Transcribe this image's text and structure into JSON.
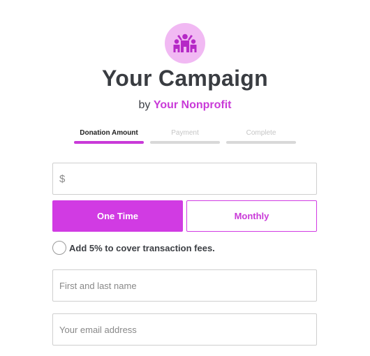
{
  "campaign": {
    "title": "Your Campaign",
    "by_prefix": "by",
    "organization": "Your Nonprofit",
    "logo_icon": "people-group-icon",
    "accent_color": "#d13be3"
  },
  "steps": [
    {
      "label": "Donation Amount",
      "state": "active"
    },
    {
      "label": "Payment",
      "state": "inactive"
    },
    {
      "label": "Complete",
      "state": "inactive"
    }
  ],
  "amount": {
    "currency_symbol": "$",
    "value": ""
  },
  "frequency": {
    "one_time_label": "One Time",
    "monthly_label": "Monthly",
    "selected": "One Time"
  },
  "fees": {
    "label": "Add 5% to cover transaction fees.",
    "checked": false
  },
  "name_field": {
    "placeholder": "First and last name",
    "value": ""
  },
  "email_field": {
    "placeholder": "Your email address",
    "value": ""
  }
}
